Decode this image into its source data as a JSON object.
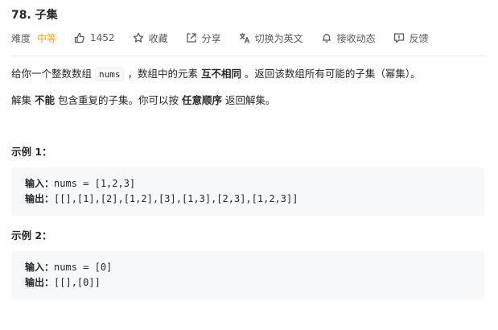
{
  "problem": {
    "title": "78. 子集"
  },
  "meta": {
    "difficulty_label": "难度",
    "difficulty_value": "中等",
    "likes": "1452",
    "favorite": "收藏",
    "share": "分享",
    "switch_lang": "切换为英文",
    "subscribe": "接收动态",
    "feedback": "反馈",
    "difficulty_color": "#ffa116",
    "icons": {
      "likes": "thumbs-up-icon",
      "favorite": "star-icon",
      "share": "share-icon",
      "switch_lang": "translate-icon",
      "subscribe": "bell-icon",
      "feedback": "feedback-icon"
    }
  },
  "description": {
    "p1_a": "给你一个整数数组 ",
    "p1_code": "nums",
    "p1_b": " ，数组中的元素 ",
    "p1_bold": "互不相同",
    "p1_c": " 。返回该数组所有可能的子集（幂集）。",
    "p2_a": "解集 ",
    "p2_bold1": "不能",
    "p2_b": " 包含重复的子集。你可以按 ",
    "p2_bold2": "任意顺序",
    "p2_c": " 返回解集。"
  },
  "examples": [
    {
      "title": "示例 1：",
      "input_label": "输入：",
      "input": "nums = [1,2,3]",
      "output_label": "输出：",
      "output": "[[],[1],[2],[1,2],[3],[1,3],[2,3],[1,2,3]]"
    },
    {
      "title": "示例 2：",
      "input_label": "输入：",
      "input": "nums = [0]",
      "output_label": "输出：",
      "output": "[[],[0]]"
    }
  ]
}
